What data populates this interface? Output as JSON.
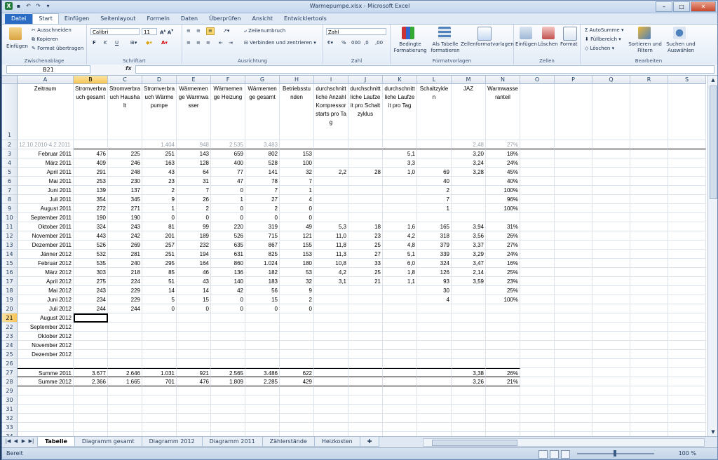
{
  "window": {
    "title": "Warmepumpe.xlsx - Microsoft Excel"
  },
  "ribbon_tabs": [
    "Datei",
    "Start",
    "Einfügen",
    "Seitenlayout",
    "Formeln",
    "Daten",
    "Überprüfen",
    "Ansicht",
    "Entwicklertools"
  ],
  "ribbon": {
    "clipboard": {
      "paste": "Einfügen",
      "cut": "Ausschneiden",
      "copy": "Kopieren",
      "format_painter": "Format übertragen",
      "label": "Zwischenablage"
    },
    "font": {
      "name": "Calibri",
      "size": "11",
      "label": "Schriftart"
    },
    "alignment": {
      "wrap": "Zeilenumbruch",
      "merge": "Verbinden und zentrieren",
      "label": "Ausrichtung"
    },
    "number": {
      "format": "Zahl",
      "label": "Zahl"
    },
    "styles": {
      "conditional": "Bedingte Formatierung",
      "as_table": "Als Tabelle formatieren",
      "cell_styles": "Zellenformatvorlagen",
      "label": "Formatvorlagen"
    },
    "cells": {
      "insert": "Einfügen",
      "delete": "Löschen",
      "format": "Format",
      "label": "Zellen"
    },
    "editing": {
      "autosum": "AutoSumme",
      "fill": "Füllbereich",
      "clear": "Löschen",
      "sort": "Sortieren und Filtern",
      "find": "Suchen und Auswählen",
      "label": "Bearbeiten"
    }
  },
  "formula_bar": {
    "name_box": "B21",
    "fx": "fx",
    "content": ""
  },
  "columns": [
    "A",
    "B",
    "C",
    "D",
    "E",
    "F",
    "G",
    "H",
    "I",
    "J",
    "K",
    "L",
    "M",
    "N",
    "O",
    "P",
    "Q",
    "R",
    "S"
  ],
  "headers": {
    "A": "Zeitraum",
    "B": "Stromverbrauch gesamt",
    "C": "Stromverbrauch Haushalt",
    "D": "Stromverbrauch Wärmepumpe",
    "E": "Wärmemenge Warmwasser",
    "F": "Wärmemenge Heizung",
    "G": "Wärmemenge gesamt",
    "H": "Betriebsstunden",
    "I": "durchschnittliche Anzahl Kompressorstarts pro Tag",
    "J": "durchschnittliche Laufzeit pro Schaltzyklus",
    "K": "durchschnittliche Laufzeit pro Tag",
    "L": "Schaltzyklen",
    "M": "JAZ",
    "N": "Warmwasseranteil"
  },
  "rows": [
    {
      "n": "2",
      "gray": true,
      "A": "12.10.2010-4.2.2011",
      "D": "1.404",
      "E": "948",
      "F": "2.535",
      "G": "3.483",
      "M": "2,48",
      "N": "27%"
    },
    {
      "n": "3",
      "A": "Februar 2011",
      "B": "476",
      "C": "225",
      "D": "251",
      "E": "143",
      "F": "659",
      "G": "802",
      "H": "153",
      "K": "5,1",
      "M": "3,20",
      "N": "18%"
    },
    {
      "n": "4",
      "A": "März 2011",
      "B": "409",
      "C": "246",
      "D": "163",
      "E": "128",
      "F": "400",
      "G": "528",
      "H": "100",
      "K": "3,3",
      "M": "3,24",
      "N": "24%"
    },
    {
      "n": "5",
      "A": "April 2011",
      "B": "291",
      "C": "248",
      "D": "43",
      "E": "64",
      "F": "77",
      "G": "141",
      "H": "32",
      "I": "2,2",
      "J": "28",
      "K": "1,0",
      "L": "69",
      "M": "3,28",
      "N": "45%"
    },
    {
      "n": "6",
      "A": "Mai 2011",
      "B": "253",
      "C": "230",
      "D": "23",
      "E": "31",
      "F": "47",
      "G": "78",
      "H": "7",
      "L": "40",
      "N": "40%"
    },
    {
      "n": "7",
      "A": "Juni 2011",
      "B": "139",
      "C": "137",
      "D": "2",
      "E": "7",
      "F": "0",
      "G": "7",
      "H": "1",
      "L": "2",
      "N": "100%"
    },
    {
      "n": "8",
      "A": "Juli 2011",
      "B": "354",
      "C": "345",
      "D": "9",
      "E": "26",
      "F": "1",
      "G": "27",
      "H": "4",
      "L": "7",
      "N": "96%"
    },
    {
      "n": "9",
      "A": "August 2011",
      "B": "272",
      "C": "271",
      "D": "1",
      "E": "2",
      "F": "0",
      "G": "2",
      "H": "0",
      "L": "1",
      "N": "100%"
    },
    {
      "n": "10",
      "A": "September 2011",
      "B": "190",
      "C": "190",
      "D": "0",
      "E": "0",
      "F": "0",
      "G": "0",
      "H": "0"
    },
    {
      "n": "11",
      "A": "Oktober 2011",
      "B": "324",
      "C": "243",
      "D": "81",
      "E": "99",
      "F": "220",
      "G": "319",
      "H": "49",
      "I": "5,3",
      "J": "18",
      "K": "1,6",
      "L": "165",
      "M": "3,94",
      "N": "31%"
    },
    {
      "n": "12",
      "A": "November 2011",
      "B": "443",
      "C": "242",
      "D": "201",
      "E": "189",
      "F": "526",
      "G": "715",
      "H": "121",
      "I": "11,0",
      "J": "23",
      "K": "4,2",
      "L": "318",
      "M": "3,56",
      "N": "26%"
    },
    {
      "n": "13",
      "A": "Dezember 2011",
      "B": "526",
      "C": "269",
      "D": "257",
      "E": "232",
      "F": "635",
      "G": "867",
      "H": "155",
      "I": "11,8",
      "J": "25",
      "K": "4,8",
      "L": "379",
      "M": "3,37",
      "N": "27%"
    },
    {
      "n": "14",
      "A": "Jänner 2012",
      "B": "532",
      "C": "281",
      "D": "251",
      "E": "194",
      "F": "631",
      "G": "825",
      "H": "153",
      "I": "11,3",
      "J": "27",
      "K": "5,1",
      "L": "339",
      "M": "3,29",
      "N": "24%"
    },
    {
      "n": "15",
      "A": "Februar 2012",
      "B": "535",
      "C": "240",
      "D": "295",
      "E": "164",
      "F": "860",
      "G": "1.024",
      "H": "180",
      "I": "10,8",
      "J": "33",
      "K": "6,0",
      "L": "324",
      "M": "3,47",
      "N": "16%"
    },
    {
      "n": "16",
      "A": "März 2012",
      "B": "303",
      "C": "218",
      "D": "85",
      "E": "46",
      "F": "136",
      "G": "182",
      "H": "53",
      "I": "4,2",
      "J": "25",
      "K": "1,8",
      "L": "126",
      "M": "2,14",
      "N": "25%"
    },
    {
      "n": "17",
      "A": "April 2012",
      "B": "275",
      "C": "224",
      "D": "51",
      "E": "43",
      "F": "140",
      "G": "183",
      "H": "32",
      "I": "3,1",
      "J": "21",
      "K": "1,1",
      "L": "93",
      "M": "3,59",
      "N": "23%"
    },
    {
      "n": "18",
      "A": "Mai 2012",
      "B": "243",
      "C": "229",
      "D": "14",
      "E": "14",
      "F": "42",
      "G": "56",
      "H": "9",
      "L": "30",
      "N": "25%"
    },
    {
      "n": "19",
      "A": "Juni 2012",
      "B": "234",
      "C": "229",
      "D": "5",
      "E": "15",
      "F": "0",
      "G": "15",
      "H": "2",
      "L": "4",
      "N": "100%"
    },
    {
      "n": "20",
      "A": "Juli 2012",
      "B": "244",
      "C": "244",
      "D": "0",
      "E": "0",
      "F": "0",
      "G": "0",
      "H": "0"
    },
    {
      "n": "21",
      "A": "August 2012"
    },
    {
      "n": "22",
      "A": "September 2012"
    },
    {
      "n": "23",
      "A": "Oktober 2012"
    },
    {
      "n": "24",
      "A": "November 2012"
    },
    {
      "n": "25",
      "A": "Dezember 2012"
    },
    {
      "n": "26"
    },
    {
      "n": "27",
      "A": "Summe 2011",
      "B": "3.677",
      "C": "2.646",
      "D": "1.031",
      "E": "921",
      "F": "2.565",
      "G": "3.486",
      "H": "622",
      "M": "3,38",
      "N": "26%"
    },
    {
      "n": "28",
      "A": "Summe 2012",
      "B": "2.366",
      "C": "1.665",
      "D": "701",
      "E": "476",
      "F": "1.809",
      "G": "2.285",
      "H": "429",
      "M": "3,26",
      "N": "21%"
    },
    {
      "n": "29"
    },
    {
      "n": "30"
    },
    {
      "n": "31"
    },
    {
      "n": "32"
    },
    {
      "n": "33"
    },
    {
      "n": "34"
    }
  ],
  "sheet_tabs": [
    "Tabelle",
    "Diagramm gesamt",
    "Diagramm 2012",
    "Diagramm 2011",
    "Zählerstände",
    "Heizkosten"
  ],
  "status": {
    "ready": "Bereit",
    "zoom": "100 %"
  }
}
